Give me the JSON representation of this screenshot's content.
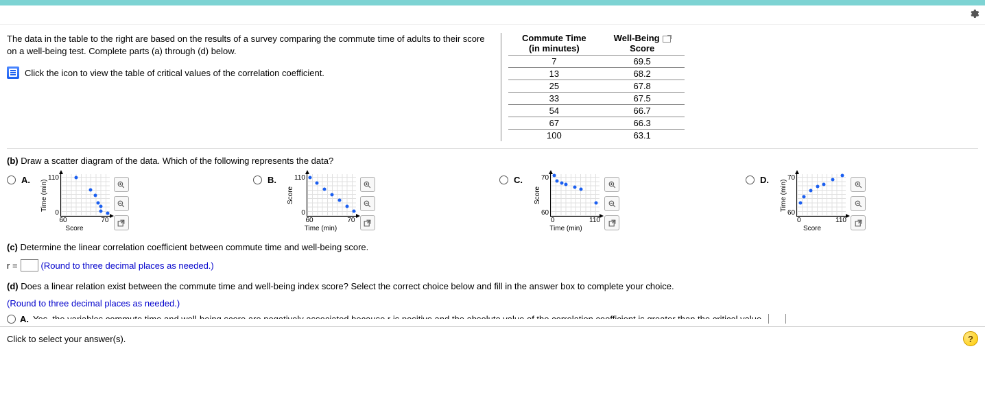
{
  "prompt": {
    "main": "The data in the table to the right are based on the results of a survey comparing the commute time of adults to their score on a well-being test. Complete parts (a) through (d) below.",
    "link": "Click the icon to view the table of critical values of the correlation coefficient."
  },
  "table": {
    "h1a": "Commute Time",
    "h1b": "(in minutes)",
    "h2a": "Well-Being",
    "h2b": "Score",
    "rows": [
      {
        "t": "7",
        "s": "69.5"
      },
      {
        "t": "13",
        "s": "68.2"
      },
      {
        "t": "25",
        "s": "67.8"
      },
      {
        "t": "33",
        "s": "67.5"
      },
      {
        "t": "54",
        "s": "66.7"
      },
      {
        "t": "67",
        "s": "66.3"
      },
      {
        "t": "100",
        "s": "63.1"
      }
    ]
  },
  "partB": {
    "label_b": "(b)",
    "text": " Draw a scatter diagram of the data. Which of the following represents the data?",
    "options": {
      "A": {
        "label": "A.",
        "xl": "Score",
        "yl": "Time (min)",
        "xt0": "60",
        "xt1": "70",
        "yt0": "0",
        "yt1": "110"
      },
      "B": {
        "label": "B.",
        "xl": "Time (min)",
        "yl": "Score",
        "xt0": "60",
        "xt1": "70",
        "yt0": "0",
        "yt1": "110"
      },
      "C": {
        "label": "C.",
        "xl": "Time (min)",
        "yl": "Score",
        "xt0": "0",
        "xt1": "110",
        "yt0": "60",
        "yt1": "70"
      },
      "D": {
        "label": "D.",
        "xl": "Score",
        "yl": "Time (min)",
        "xt0": "0",
        "xt1": "110",
        "yt0": "60",
        "yt1": "70"
      }
    }
  },
  "partC": {
    "label_c": "(c)",
    "text": " Determine the linear correlation coefficient between commute time and well-being score.",
    "r_prefix": "r =",
    "hint": "(Round to three decimal places as needed.)"
  },
  "partD": {
    "label_d": "(d)",
    "text": " Does a linear relation exist between the commute time and well-being index score? Select the correct choice below and fill in the answer box to complete your choice.",
    "hint": "(Round to three decimal places as needed.)",
    "optA_label": "A.",
    "optA_text": "Yes, the variables commute time and well-being score are negatively associated because r is positive and the absolute value of the correlation coefficient is greater than the critical value,"
  },
  "footer": {
    "text": "Click to select your answer(s).",
    "help": "?"
  },
  "chart_data": [
    {
      "option": "A",
      "type": "scatter",
      "xlabel": "Score",
      "ylabel": "Time (min)",
      "xlim": [
        60,
        70
      ],
      "ylim": [
        0,
        110
      ],
      "points": [
        {
          "x": 63,
          "y": 100
        },
        {
          "x": 66,
          "y": 67
        },
        {
          "x": 67,
          "y": 54
        },
        {
          "x": 67.5,
          "y": 33
        },
        {
          "x": 68,
          "y": 25
        },
        {
          "x": 68,
          "y": 13
        },
        {
          "x": 69.5,
          "y": 7
        }
      ]
    },
    {
      "option": "B",
      "type": "scatter",
      "xlabel": "Time (min)",
      "ylabel": "Score",
      "xlim": [
        60,
        70
      ],
      "ylim": [
        0,
        110
      ],
      "points": [
        {
          "x": 60.5,
          "y": 100
        },
        {
          "x": 62,
          "y": 85
        },
        {
          "x": 63.5,
          "y": 70
        },
        {
          "x": 65,
          "y": 55
        },
        {
          "x": 66.5,
          "y": 40
        },
        {
          "x": 68,
          "y": 25
        },
        {
          "x": 69.5,
          "y": 12
        }
      ]
    },
    {
      "option": "C",
      "type": "scatter",
      "xlabel": "Time (min)",
      "ylabel": "Score",
      "xlim": [
        0,
        110
      ],
      "ylim": [
        60,
        70
      ],
      "points": [
        {
          "x": 7,
          "y": 69.5
        },
        {
          "x": 13,
          "y": 68.2
        },
        {
          "x": 25,
          "y": 67.8
        },
        {
          "x": 33,
          "y": 67.5
        },
        {
          "x": 54,
          "y": 66.7
        },
        {
          "x": 67,
          "y": 66.3
        },
        {
          "x": 100,
          "y": 63.1
        }
      ]
    },
    {
      "option": "D",
      "type": "scatter",
      "xlabel": "Score",
      "ylabel": "Time (min)",
      "xlim": [
        0,
        110
      ],
      "ylim": [
        60,
        70
      ],
      "points": [
        {
          "x": 7,
          "y": 63
        },
        {
          "x": 15,
          "y": 64.5
        },
        {
          "x": 30,
          "y": 66
        },
        {
          "x": 45,
          "y": 67
        },
        {
          "x": 60,
          "y": 67.5
        },
        {
          "x": 80,
          "y": 68.5
        },
        {
          "x": 100,
          "y": 69.5
        }
      ]
    }
  ]
}
